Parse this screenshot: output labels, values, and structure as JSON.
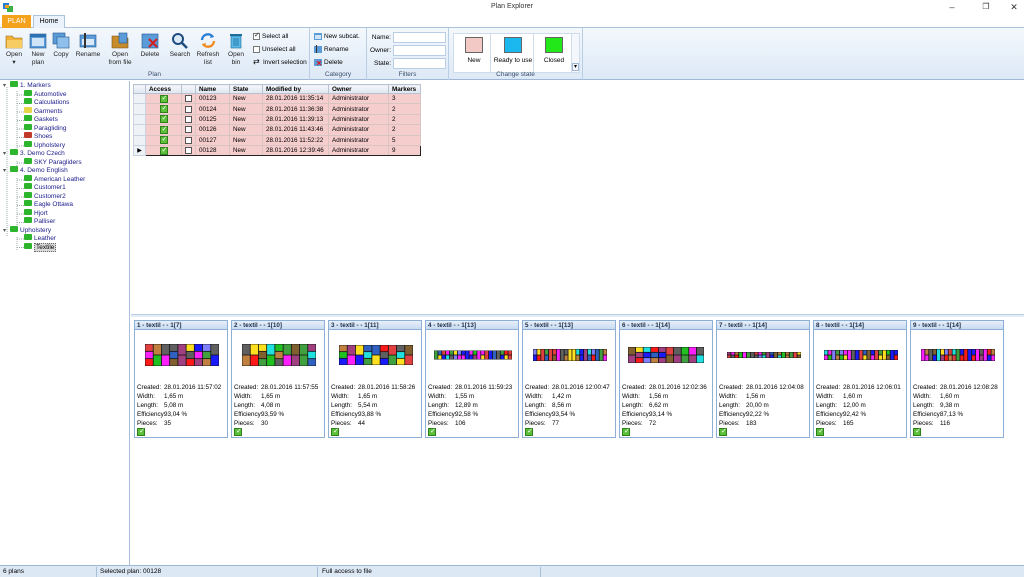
{
  "window": {
    "title": "Plan Explorer"
  },
  "ribbon": {
    "tabs": [
      {
        "label": "PLAN"
      },
      {
        "label": "Home"
      }
    ],
    "plan_group": {
      "label": "Plan",
      "buttons": [
        {
          "label": "Open",
          "sub": "▾",
          "icon": "open-folder-icon"
        },
        {
          "label": "New",
          "sub": "plan",
          "icon": "new-plan-icon"
        },
        {
          "label": "Copy",
          "sub": "",
          "icon": "copy-icon"
        },
        {
          "label": "Rename",
          "sub": "",
          "icon": "rename-icon"
        },
        {
          "label": "Open",
          "sub": "from file",
          "icon": "open-file-icon"
        },
        {
          "label": "Delete",
          "sub": "",
          "icon": "delete-icon"
        },
        {
          "label": "Search",
          "sub": "",
          "icon": "search-icon"
        },
        {
          "label": "Refresh",
          "sub": "list",
          "icon": "refresh-icon"
        },
        {
          "label": "Open",
          "sub": "bin",
          "icon": "bin-icon"
        }
      ],
      "select_all": "Select all",
      "unselect_all": "Unselect all",
      "invert_selection": "Invert selection"
    },
    "category_group": {
      "label": "Category",
      "new_subcat": "New subcat.",
      "rename": "Rename",
      "delete": "Delete"
    },
    "filters_group": {
      "label": "Filters",
      "name_label": "Name:",
      "owner_label": "Owner:",
      "state_label": "State:",
      "name_value": "",
      "owner_value": "",
      "state_value": ""
    },
    "state_group": {
      "label": "Change state",
      "states": [
        {
          "label": "New",
          "color": "#f2c9c4"
        },
        {
          "label": "Ready to use",
          "color": "#1ab8ef"
        },
        {
          "label": "Closed",
          "color": "#22e81a"
        }
      ]
    }
  },
  "tree": {
    "nodes": [
      {
        "label": "1. Markers",
        "level": 0,
        "color": "#2db52d",
        "expanded": true
      },
      {
        "label": "Automotive",
        "level": 1,
        "color": "#2db52d"
      },
      {
        "label": "Calculations",
        "level": 1,
        "color": "#2db52d"
      },
      {
        "label": "Garments",
        "level": 1,
        "color": "#e8d64a"
      },
      {
        "label": "Gaskets",
        "level": 1,
        "color": "#2db52d"
      },
      {
        "label": "Paragliding",
        "level": 1,
        "color": "#2db52d"
      },
      {
        "label": "Shoes",
        "level": 1,
        "color": "#c0392b"
      },
      {
        "label": "Upholstery",
        "level": 1,
        "color": "#2db52d"
      },
      {
        "label": "3. Demo Czech",
        "level": 0,
        "color": "#2db52d",
        "expanded": true
      },
      {
        "label": "SKY Paragliders",
        "level": 1,
        "color": "#2db52d"
      },
      {
        "label": "4. Demo English",
        "level": 0,
        "color": "#2db52d",
        "expanded": true
      },
      {
        "label": "American Leather",
        "level": 1,
        "color": "#2db52d"
      },
      {
        "label": "Customer1",
        "level": 1,
        "color": "#2db52d"
      },
      {
        "label": "Customer2",
        "level": 1,
        "color": "#2db52d"
      },
      {
        "label": "Eagle Ottawa",
        "level": 1,
        "color": "#2db52d"
      },
      {
        "label": "Hjort",
        "level": 1,
        "color": "#2db52d"
      },
      {
        "label": "Palliser",
        "level": 1,
        "color": "#2db52d"
      },
      {
        "label": "Upholstery",
        "level": 0,
        "color": "#2db52d",
        "expanded": true
      },
      {
        "label": "Leather",
        "level": 1,
        "color": "#2db52d"
      },
      {
        "label": "Textile",
        "level": 1,
        "color": "#2db52d",
        "selected": true
      }
    ]
  },
  "grid": {
    "columns": [
      "Access",
      "",
      "Name",
      "State",
      "Modified by",
      "Owner",
      "Markers"
    ],
    "rows": [
      {
        "name": "00123",
        "state": "New",
        "modified": "28.01.2016 11:35:14",
        "owner": "Administrator",
        "markers": "3"
      },
      {
        "name": "00124",
        "state": "New",
        "modified": "28.01.2016 11:36:38",
        "owner": "Administrator",
        "markers": "2"
      },
      {
        "name": "00125",
        "state": "New",
        "modified": "28.01.2016 11:39:13",
        "owner": "Administrator",
        "markers": "2"
      },
      {
        "name": "00126",
        "state": "New",
        "modified": "28.01.2016 11:43:46",
        "owner": "Administrator",
        "markers": "2"
      },
      {
        "name": "00127",
        "state": "New",
        "modified": "28.01.2016 11:52:22",
        "owner": "Administrator",
        "markers": "5"
      },
      {
        "name": "00128",
        "state": "New",
        "modified": "28.01.2016 12:39:46",
        "owner": "Administrator",
        "markers": "9",
        "current": true
      }
    ]
  },
  "cards": {
    "labels": {
      "created": "Created:",
      "width": "Width:",
      "length": "Length:",
      "efficiency": "Efficiency:",
      "pieces": "Pieces:"
    },
    "items": [
      {
        "title": "1 - textil - - 1[7]",
        "created": "28.01.2016  11:57:02",
        "width": "1,65 m",
        "length": "5,08 m",
        "efficiency": "93,04 %",
        "pieces": "35"
      },
      {
        "title": "2 - textil - - 1[10]",
        "created": "28.01.2016  11:57:55",
        "width": "1,65 m",
        "length": "4,08 m",
        "efficiency": "93,59 %",
        "pieces": "30"
      },
      {
        "title": "3 - textil - - 1[11]",
        "created": "28.01.2016  11:58:26",
        "width": "1,65 m",
        "length": "5,54 m",
        "efficiency": "93,88 %",
        "pieces": "44"
      },
      {
        "title": "4 - textil - - 1[13]",
        "created": "28.01.2016  11:59:23",
        "width": "1,55 m",
        "length": "12,89 m",
        "efficiency": "92,58 %",
        "pieces": "106"
      },
      {
        "title": "5 - textil - - 1[13]",
        "created": "28.01.2016  12:00:47",
        "width": "1,42 m",
        "length": "8,56 m",
        "efficiency": "93,54 %",
        "pieces": "77"
      },
      {
        "title": "6 - textil - - 1[14]",
        "created": "28.01.2016  12:02:36",
        "width": "1,56 m",
        "length": "6,62 m",
        "efficiency": "93,14 %",
        "pieces": "72"
      },
      {
        "title": "7 - textil - - 1[14]",
        "created": "28.01.2016  12:04:08",
        "width": "1,56 m",
        "length": "20,00 m",
        "efficiency": "92,22 %",
        "pieces": "183"
      },
      {
        "title": "8 - textil - - 1[14]",
        "created": "28.01.2016  12:06:01",
        "width": "1,60 m",
        "length": "12,00 m",
        "efficiency": "92,42 %",
        "pieces": "165"
      },
      {
        "title": "9 - textil - - 1[14]",
        "created": "28.01.2016  12:08:28",
        "width": "1,60 m",
        "length": "9,38 m",
        "efficiency": "87,13 %",
        "pieces": "116"
      }
    ]
  },
  "status": {
    "count": "6 plans",
    "selected": "Selected plan:  00128",
    "access": "Full access to file"
  }
}
